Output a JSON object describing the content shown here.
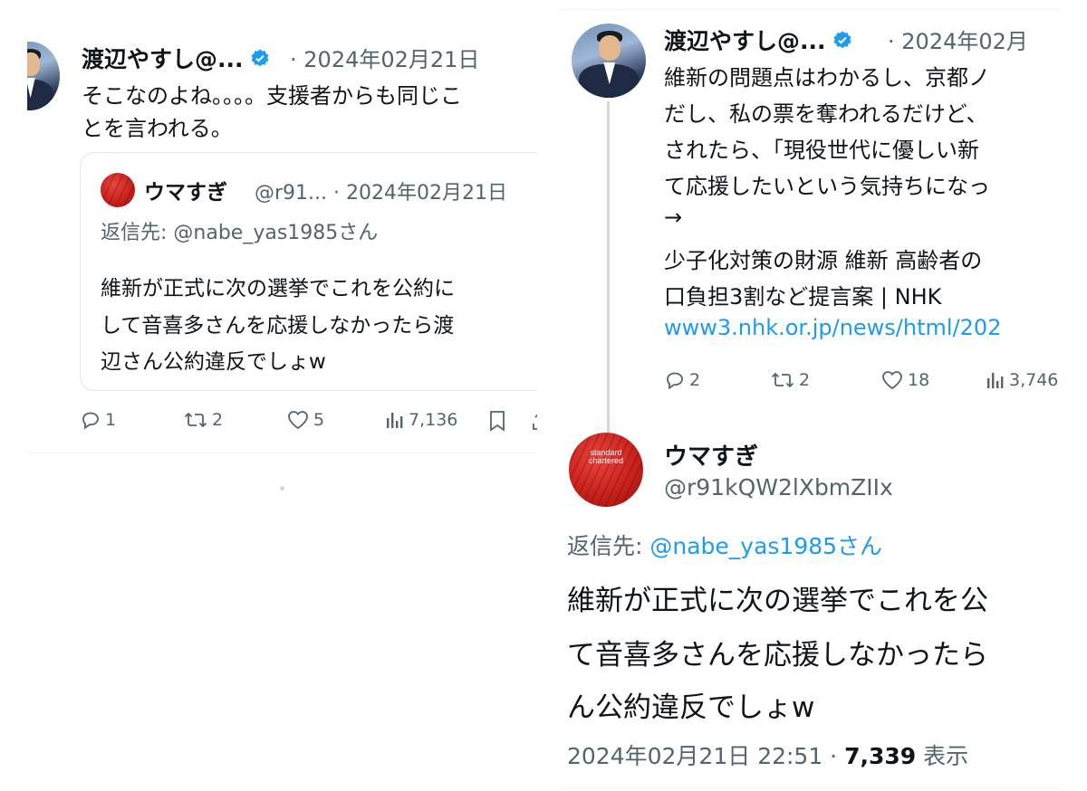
{
  "left": {
    "author_name": "渡辺やすし@...",
    "dot": "·",
    "date": "2024年02月21日",
    "text_lines": [
      "そこなのよね。。。。支援者からも同じこ",
      "とを言われる。"
    ],
    "quote": {
      "author_name": "ウマすぎ",
      "handle": "@r91...",
      "dot": "·",
      "date": "2024年02月21日",
      "reply_to_prefix": "返信先: ",
      "reply_to_handle": "@nabe_yas1985さん",
      "text_lines": [
        "維新が正式に次の選挙でこれを公約に",
        "して音喜多さんを応援しなかったら渡",
        "辺さん公約違反でしょw"
      ]
    },
    "actions": {
      "reply": "1",
      "retweet": "2",
      "like": "5",
      "views": "7,136"
    }
  },
  "right": {
    "author_name": "渡辺やすし@...",
    "dot": "·",
    "date": "2024年02月",
    "text_lines": [
      "維新の問題点はわかるし、京都ノ",
      "だし、私の票を奪われるだけど、",
      "されたら、「現役世代に優しい新",
      "て応援したいという気持ちになっ",
      "→",
      "少子化対策の財源 維新 高齢者の",
      "口負担3割など提言案 | NHK"
    ],
    "link_text": "www3.nhk.or.jp/news/html/202",
    "actions": {
      "reply": "2",
      "retweet": "2",
      "like": "18",
      "views": "3,746"
    },
    "reply": {
      "author_name": "ウマすぎ",
      "handle": "@r91kQW2lXbmZIIx",
      "reply_to_prefix": "返信先: ",
      "reply_to_handle": "@nabe_yas1985さん",
      "text_lines": [
        "維新が正式に次の選挙でこれを公",
        "て音喜多さんを応援しなかったら",
        "ん公約違反でしょw"
      ],
      "timestamp": "2024年02月21日 22:51 · ",
      "view_count": "7,339",
      "view_label": " 表示"
    }
  },
  "avatar_logo_text": "standard chartered",
  "colors": {
    "link": "#1d9bf0",
    "muted": "#536471",
    "verified": "#1d9bf0",
    "avatar_red": "#c8221d"
  }
}
